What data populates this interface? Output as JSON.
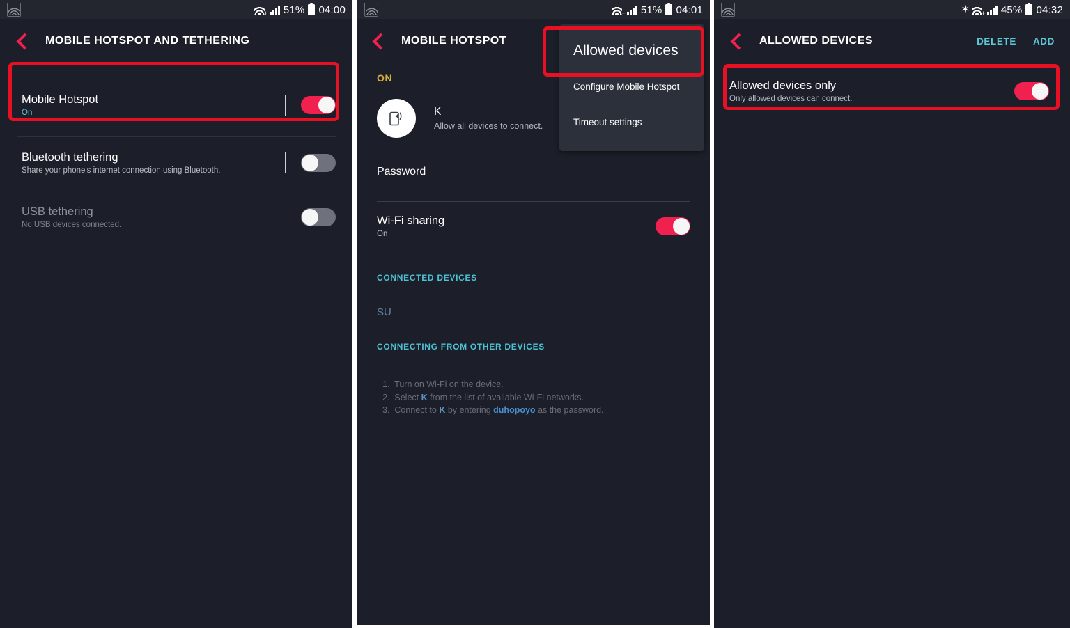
{
  "panel1": {
    "status_bar": {
      "notification_icon": "wifi-hotspot-notification-icon",
      "wifi_icon": "wifi-icon",
      "signal_icon": "cellular-signal-icon",
      "battery_percent": "51%",
      "battery_icon": "battery-icon",
      "time": "04:00"
    },
    "action_bar": {
      "back_icon": "back-chevron-icon",
      "title": "MOBILE HOTSPOT AND TETHERING"
    },
    "rows": [
      {
        "title": "Mobile Hotspot",
        "sub": "On",
        "toggle": "on",
        "enabled": true,
        "highlighted": true
      },
      {
        "title": "Bluetooth tethering",
        "sub": "Share your phone's internet connection using Bluetooth.",
        "toggle": "off",
        "enabled": true,
        "highlighted": false
      },
      {
        "title": "USB tethering",
        "sub": "No USB devices connected.",
        "toggle": "off",
        "enabled": false,
        "highlighted": false
      }
    ]
  },
  "panel2": {
    "status_bar": {
      "battery_percent": "51%",
      "time": "04:01"
    },
    "action_bar": {
      "title": "MOBILE HOTSPOT"
    },
    "state_label": "ON",
    "hotspot": {
      "icon": "hotspot-device-icon",
      "name": "K",
      "sub": "Allow all devices to connect."
    },
    "password_label": "Password",
    "wifi_sharing": {
      "title": "Wi-Fi sharing",
      "sub": "On",
      "toggle": "on"
    },
    "sections": [
      {
        "heading": "CONNECTED DEVICES",
        "entry": "SU"
      },
      {
        "heading": "CONNECTING FROM OTHER DEVICES"
      }
    ],
    "steps": [
      {
        "num": "1.",
        "pre": "Turn on Wi-Fi on the device.",
        "hl": "",
        "post": ""
      },
      {
        "num": "2.",
        "pre": "Select ",
        "hl": "K",
        "post": " from the list of available Wi-Fi networks."
      },
      {
        "num": "3.",
        "pre": "Connect to ",
        "hl": "K",
        "mid": " by entering ",
        "hl2": "duhopoyo",
        "post": " as the password."
      }
    ],
    "overflow_menu": {
      "items": [
        {
          "label": "Allowed devices",
          "highlighted": true
        },
        {
          "label": "Configure Mobile Hotspot",
          "highlighted": false
        },
        {
          "label": "Timeout settings",
          "highlighted": false
        }
      ]
    }
  },
  "panel3": {
    "status_bar": {
      "bluetooth_icon": "bluetooth-icon",
      "battery_percent": "45%",
      "time": "04:32"
    },
    "action_bar": {
      "title": "ALLOWED DEVICES",
      "actions": [
        {
          "label": "DELETE"
        },
        {
          "label": "ADD"
        }
      ]
    },
    "rows": [
      {
        "title": "Allowed devices only",
        "sub": "Only allowed devices can connect.",
        "toggle": "on",
        "highlighted": true
      }
    ]
  },
  "colors": {
    "accent_red": "#f0204f",
    "highlight_box": "#e81123",
    "teal": "#5ec8d8",
    "gold": "#d5b13b",
    "background": "#1c1f29",
    "statusbar_bg": "#23262f"
  }
}
